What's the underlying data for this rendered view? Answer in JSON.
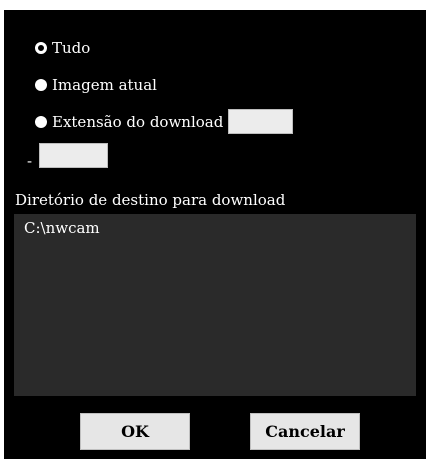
{
  "options": {
    "all_label": "Tudo",
    "current_image_label": "Imagem atual",
    "range_label": "Extensão do download",
    "range_separator": "-"
  },
  "directory": {
    "label": "Diretório de destino para download",
    "path": "C:\\nwcam"
  },
  "buttons": {
    "ok_label": "OK",
    "cancel_label": "Cancelar"
  },
  "colors": {
    "panel_bg": "#000000",
    "field_bg": "#2a2a2a",
    "button_bg": "#e6e6e6"
  }
}
